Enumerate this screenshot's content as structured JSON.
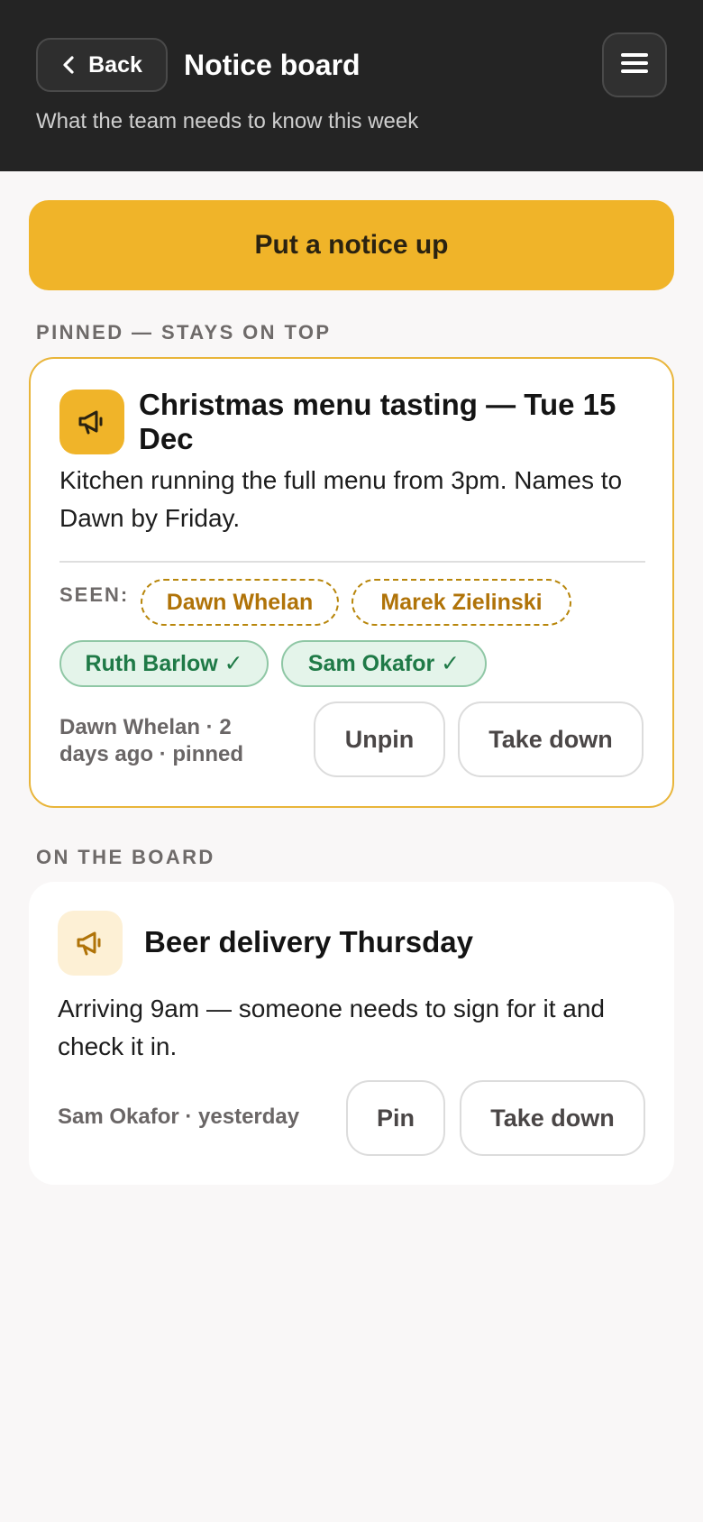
{
  "header": {
    "back_label": "Back",
    "title": "Notice board",
    "subtitle": "What the team needs to know this week"
  },
  "cta_label": "Put a notice up",
  "sections": {
    "pinned_label": "PINNED — STAYS ON TOP",
    "board_label": "ON THE BOARD"
  },
  "pinned_notice": {
    "icon": "megaphone-icon",
    "title": "Christmas menu tasting — Tue 15 Dec",
    "body": "Kitchen running the full menu from 3pm. Names to Dawn by Friday.",
    "seen_label": "SEEN:",
    "seen_by": [
      {
        "name": "Dawn Whelan",
        "seen": false
      },
      {
        "name": "Marek Zielinski",
        "seen": false
      },
      {
        "name": "Ruth Barlow ✓",
        "seen": true
      },
      {
        "name": "Sam Okafor ✓",
        "seen": true
      }
    ],
    "meta_line1": "Dawn Whelan · 2",
    "meta_line2": "days ago · pinned",
    "actions": {
      "unpin": "Unpin",
      "take_down": "Take down"
    }
  },
  "notices": [
    {
      "icon": "megaphone-icon",
      "title": "Beer delivery Thursday",
      "body": "Arriving 9am — someone needs to sign for it and check it in.",
      "meta": "Sam Okafor · yesterday",
      "actions": {
        "pin": "Pin",
        "take_down": "Take down"
      }
    }
  ],
  "colors": {
    "header_bg": "#242424",
    "accent": "#f0b429",
    "pending_chip": "#b07308",
    "seen_chip": "#1f7a47"
  }
}
